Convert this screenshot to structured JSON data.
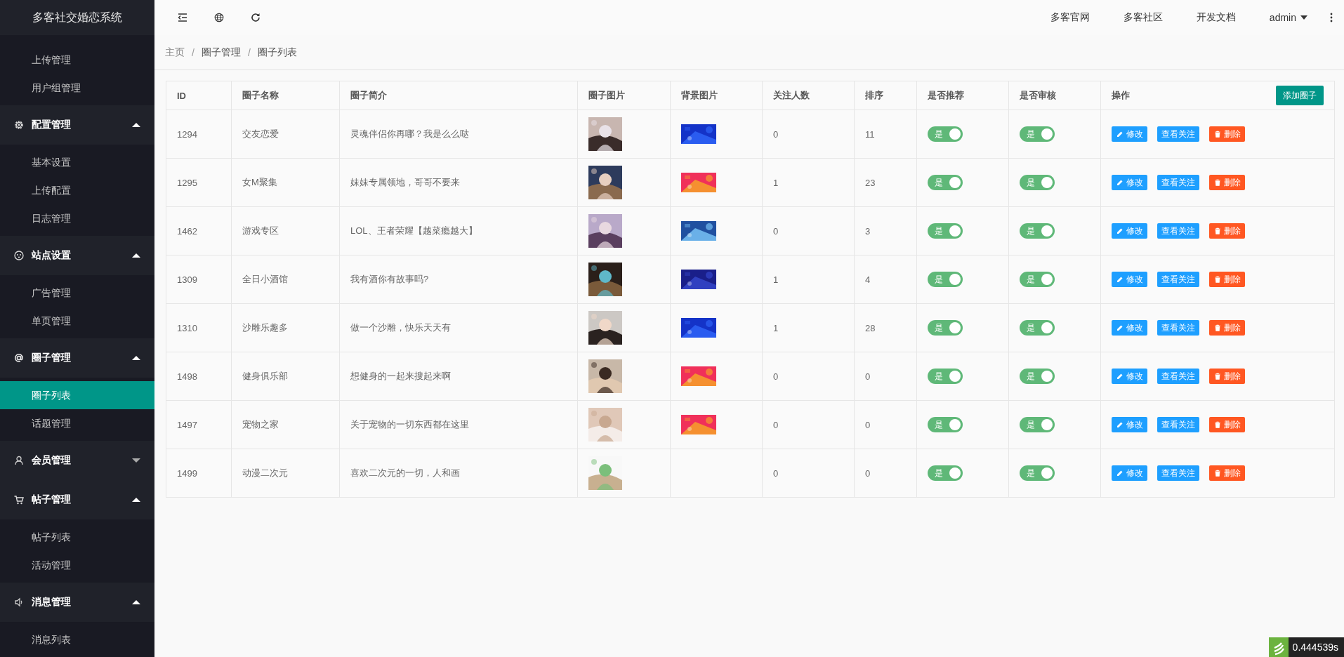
{
  "sidebar": {
    "title": "多客社交婚恋系统",
    "top_items": [
      {
        "label": "上传管理",
        "selected": false
      },
      {
        "label": "用户组管理",
        "selected": false
      }
    ],
    "groups": [
      {
        "label": "配置管理",
        "expanded": true,
        "items": [
          {
            "label": "基本设置",
            "selected": false
          },
          {
            "label": "上传配置",
            "selected": false
          },
          {
            "label": "日志管理",
            "selected": false
          }
        ]
      },
      {
        "label": "站点设置",
        "expanded": true,
        "items": [
          {
            "label": "广告管理",
            "selected": false
          },
          {
            "label": "单页管理",
            "selected": false
          }
        ]
      },
      {
        "label": "圈子管理",
        "expanded": true,
        "items": [
          {
            "label": "圈子列表",
            "selected": true
          },
          {
            "label": "话题管理",
            "selected": false
          }
        ]
      },
      {
        "label": "会员管理",
        "expanded": false
      },
      {
        "label": "帖子管理",
        "expanded": true,
        "items": [
          {
            "label": "帖子列表",
            "selected": false
          },
          {
            "label": "活动管理",
            "selected": false
          }
        ]
      },
      {
        "label": "消息管理",
        "expanded": true,
        "items": [
          {
            "label": "消息列表",
            "selected": false
          }
        ]
      }
    ]
  },
  "topbar": {
    "links": [
      "多客官网",
      "多客社区",
      "开发文档"
    ],
    "user": "admin"
  },
  "breadcrumb": {
    "items": [
      "主页",
      "圈子管理",
      "圈子列表"
    ],
    "separators": [
      "/",
      "/"
    ]
  },
  "table": {
    "columns": [
      "ID",
      "圈子名称",
      "圈子简介",
      "圈子图片",
      "背景图片",
      "关注人数",
      "排序",
      "是否推荐",
      "是否审核",
      "操作"
    ],
    "add_button": "添加圈子",
    "rows": [
      {
        "id": "1294",
        "name": "交友恋爱",
        "intro": "灵魂伴侣你再哪？我是么么哒",
        "followers": "0",
        "sort": "11",
        "recommended": {
          "label": "是",
          "on": true
        },
        "approved": {
          "label": "是",
          "on": true
        },
        "actions": [
          {
            "kind": "edit",
            "label": "修改"
          },
          {
            "kind": "follow",
            "label": "查看关注"
          },
          {
            "kind": "delete",
            "label": "删除"
          }
        ]
      },
      {
        "id": "1295",
        "name": "女M聚集",
        "intro": "妹妹专属领地，哥哥不要来",
        "followers": "1",
        "sort": "23",
        "recommended": {
          "label": "是",
          "on": true
        },
        "approved": {
          "label": "是",
          "on": true
        },
        "actions": [
          {
            "kind": "edit",
            "label": "修改"
          },
          {
            "kind": "follow",
            "label": "查看关注"
          },
          {
            "kind": "delete",
            "label": "删除"
          }
        ]
      },
      {
        "id": "1462",
        "name": "游戏专区",
        "intro": "LOL、王者荣耀【越菜瘾越大】",
        "followers": "0",
        "sort": "3",
        "recommended": {
          "label": "是",
          "on": true
        },
        "approved": {
          "label": "是",
          "on": true
        },
        "actions": [
          {
            "kind": "edit",
            "label": "修改"
          },
          {
            "kind": "follow",
            "label": "查看关注"
          },
          {
            "kind": "delete",
            "label": "删除"
          }
        ]
      },
      {
        "id": "1309",
        "name": "全日小酒馆",
        "intro": "我有酒你有故事吗?",
        "followers": "1",
        "sort": "4",
        "recommended": {
          "label": "是",
          "on": true
        },
        "approved": {
          "label": "是",
          "on": true
        },
        "actions": [
          {
            "kind": "edit",
            "label": "修改"
          },
          {
            "kind": "follow",
            "label": "查看关注"
          },
          {
            "kind": "delete",
            "label": "删除"
          }
        ]
      },
      {
        "id": "1310",
        "name": "沙雕乐趣多",
        "intro": "做一个沙雕，快乐天天有",
        "followers": "1",
        "sort": "28",
        "recommended": {
          "label": "是",
          "on": true
        },
        "approved": {
          "label": "是",
          "on": true
        },
        "actions": [
          {
            "kind": "edit",
            "label": "修改"
          },
          {
            "kind": "follow",
            "label": "查看关注"
          },
          {
            "kind": "delete",
            "label": "删除"
          }
        ]
      },
      {
        "id": "1498",
        "name": "健身俱乐部",
        "intro": "想健身的一起来搜起来啊",
        "followers": "0",
        "sort": "0",
        "recommended": {
          "label": "是",
          "on": true
        },
        "approved": {
          "label": "是",
          "on": true
        },
        "actions": [
          {
            "kind": "edit",
            "label": "修改"
          },
          {
            "kind": "follow",
            "label": "查看关注"
          },
          {
            "kind": "delete",
            "label": "删除"
          }
        ]
      },
      {
        "id": "1497",
        "name": "宠物之家",
        "intro": "关于宠物的一切东西都在这里",
        "followers": "0",
        "sort": "0",
        "recommended": {
          "label": "是",
          "on": true
        },
        "approved": {
          "label": "是",
          "on": true
        },
        "actions": [
          {
            "kind": "edit",
            "label": "修改"
          },
          {
            "kind": "follow",
            "label": "查看关注"
          },
          {
            "kind": "delete",
            "label": "删除"
          }
        ]
      },
      {
        "id": "1499",
        "name": "动漫二次元",
        "intro": "喜欢二次元的一切，人和画",
        "followers": "0",
        "sort": "0",
        "recommended": {
          "label": "是",
          "on": true
        },
        "approved": {
          "label": "是",
          "on": true
        },
        "actions": [
          {
            "kind": "edit",
            "label": "修改"
          },
          {
            "kind": "follow",
            "label": "查看关注"
          },
          {
            "kind": "delete",
            "label": "删除"
          }
        ]
      }
    ]
  },
  "debug_bar": {
    "time": "0.444539s"
  }
}
